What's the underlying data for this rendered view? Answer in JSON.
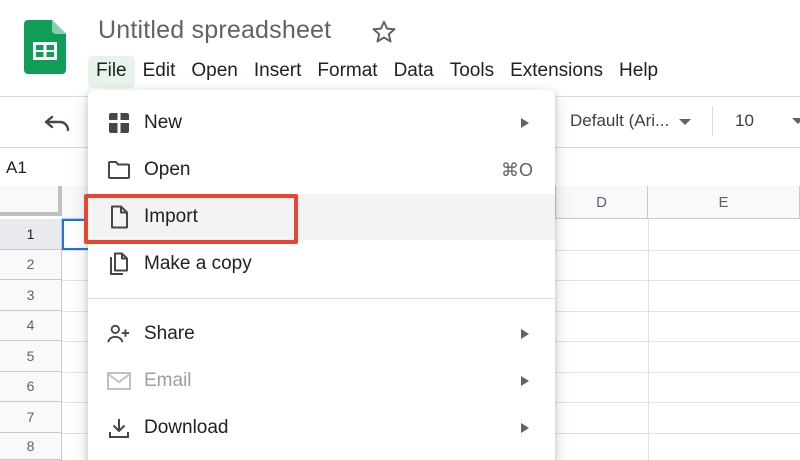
{
  "app": {
    "document_title": "Untitled spreadsheet",
    "logo_icon": "google-sheets-icon",
    "star_icon": "star-outline-icon"
  },
  "menubar": {
    "items": [
      {
        "label": "File",
        "active": true
      },
      {
        "label": "Edit"
      },
      {
        "label": "Open"
      },
      {
        "label": "Insert"
      },
      {
        "label": "Format"
      },
      {
        "label": "Data"
      },
      {
        "label": "Tools"
      },
      {
        "label": "Extensions"
      },
      {
        "label": "Help"
      }
    ]
  },
  "toolbar": {
    "undo_icon": "undo-icon",
    "font_family": "Default (Ari...",
    "font_size": "10"
  },
  "formula_bar": {
    "name_box": "A1"
  },
  "grid": {
    "columns": [
      "D",
      "E"
    ],
    "rows": [
      "1",
      "2",
      "3",
      "4",
      "5",
      "6",
      "7",
      "8"
    ],
    "selected_row": "1"
  },
  "file_menu": {
    "items": [
      {
        "label": "New",
        "icon": "new-icon",
        "submenu": true
      },
      {
        "label": "Open",
        "icon": "folder-icon",
        "shortcut": "⌘O"
      },
      {
        "label": "Import",
        "icon": "file-icon",
        "hover": true
      },
      {
        "label": "Make a copy",
        "icon": "copy-icon"
      },
      {
        "label": "Share",
        "icon": "share-person-icon",
        "submenu": true
      },
      {
        "label": "Email",
        "icon": "email-icon",
        "submenu": true,
        "disabled": true
      },
      {
        "label": "Download",
        "icon": "download-icon",
        "submenu": true
      }
    ]
  },
  "colors": {
    "accent_green": "#0f9d58",
    "highlight_box": "#e8442f",
    "active_menu_bg": "#e6f4ea",
    "selection_blue": "#1a73e8"
  }
}
